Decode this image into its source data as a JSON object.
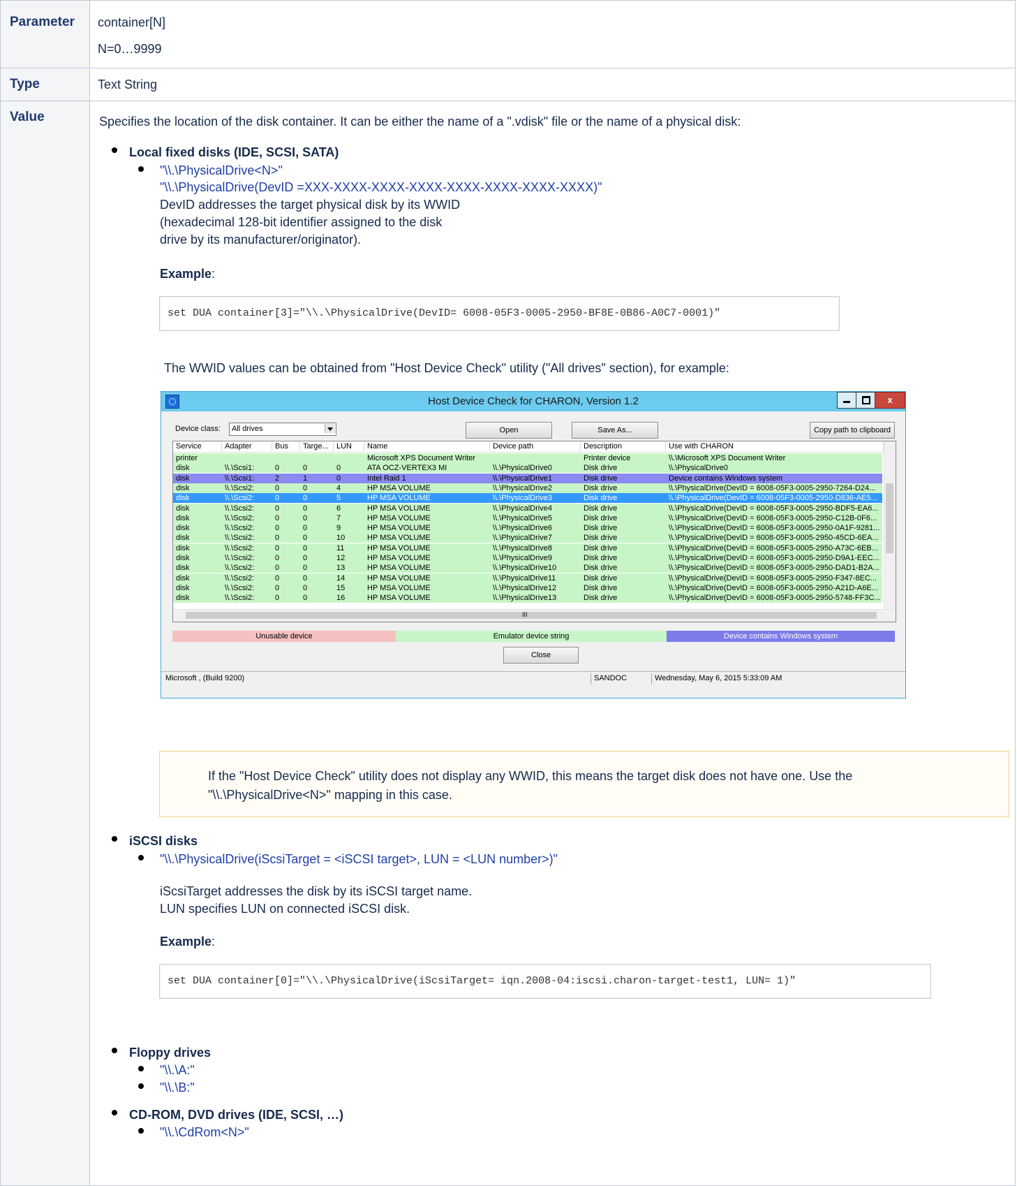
{
  "parameter": {
    "header": "Parameter",
    "line1": "container[N]",
    "line2": "N=0…9999"
  },
  "type": {
    "header": "Type",
    "value": "Text String"
  },
  "value": {
    "header": "Value",
    "intro": "Specifies the location of the disk container. It can be either the name of a \".vdisk\" file or the name of a physical disk:",
    "local_heading": "Local fixed disks (IDE, SCSI, SATA)",
    "local_link1": "\"\\\\.\\PhysicalDrive<N>\"",
    "local_link2": "\"\\\\.\\PhysicalDrive(DevID =XXX-XXXX-XXXX-XXXX-XXXX-XXXX-XXXX-XXXX)\"",
    "devid_desc_1": "DevID addresses the target physical disk by its WWID",
    "devid_desc_2": "(hexadecimal 128-bit identifier assigned to the disk",
    "devid_desc_3": "drive by its manufacturer/originator).",
    "example_label": "Example",
    "example_colon": ":",
    "code1": "set DUA container[3]=\"\\\\.\\PhysicalDrive(DevID= 6008-05F3-0005-2950-BF8E-0B86-A0C7-0001)\"",
    "wwid_note": "The WWID values can be obtained from \"Host Device Check\" utility (\"All drives\" section), for example:",
    "note_line1": "If the \"Host Device Check\" utility does not display any WWID, this means the target disk does not have one. Use the",
    "note_line2": "\"\\\\.\\PhysicalDrive<N>\" mapping in this case.",
    "iscsi_heading": "iSCSI disks",
    "iscsi_link": "\"\\\\.\\PhysicalDrive(iScsiTarget = <iSCSI target>, LUN = <LUN number>)\"",
    "iscsi_desc_1": "iScsiTarget addresses the disk by its iSCSI target name.",
    "iscsi_desc_2": "LUN specifies LUN on connected iSCSI disk.",
    "code2": "set DUA container[0]=\"\\\\.\\PhysicalDrive(iScsiTarget= iqn.2008-04:iscsi.charon-target-test1, LUN= 1)\"",
    "floppy_heading": "Floppy drives",
    "floppy_a": "\"\\\\.\\A:\"",
    "floppy_b": "\"\\\\.\\B:\"",
    "cdrom_heading": "CD-ROM, DVD drives (IDE, SCSI, …)",
    "cdrom_link": "\"\\\\.\\CdRom<N>\""
  },
  "window": {
    "title": "Host Device Check for CHARON, Version 1.2",
    "close_glyph": "x",
    "device_class_label": "Device class:",
    "device_class_value": "All drives",
    "open_button": "Open",
    "save_as_button": "Save As...",
    "copy_button": "Copy path to clipboard",
    "columns": [
      "Service",
      "Adapter",
      "Bus",
      "Targe...",
      "LUN",
      "Name",
      "Device path",
      "Description",
      "Use with CHARON"
    ],
    "rows": [
      [
        "printer",
        "",
        "",
        "",
        "",
        "Microsoft XPS Document Writer",
        "",
        "Printer device",
        "\\\\.\\Microsoft XPS Document Writer"
      ],
      [
        "disk",
        "\\\\.\\Scsi1:",
        "0",
        "0",
        "0",
        "ATA OCZ-VERTEX3 MI",
        "\\\\.\\PhysicalDrive0",
        "Disk drive",
        "\\\\.\\PhysicalDrive0"
      ],
      [
        "disk",
        "\\\\.\\Scsi1:",
        "2",
        "1",
        "0",
        "Intel Raid 1",
        "\\\\.\\PhysicalDrive1",
        "Disk drive",
        "Device contains Windows system"
      ],
      [
        "disk",
        "\\\\.\\Scsi2:",
        "0",
        "0",
        "4",
        "HP MSA VOLUME",
        "\\\\.\\PhysicalDrive2",
        "Disk drive",
        "\\\\.\\PhysicalDrive(DevID = 6008-05F3-0005-2950-7264-D24..."
      ],
      [
        "disk",
        "\\\\.\\Scsi2:",
        "0",
        "0",
        "5",
        "HP MSA VOLUME",
        "\\\\.\\PhysicalDrive3",
        "Disk drive",
        "\\\\.\\PhysicalDrive(DevID = 6008-05F3-0005-2950-D836-AE5..."
      ],
      [
        "disk",
        "\\\\.\\Scsi2:",
        "0",
        "0",
        "6",
        "HP MSA VOLUME",
        "\\\\.\\PhysicalDrive4",
        "Disk drive",
        "\\\\.\\PhysicalDrive(DevID = 6008-05F3-0005-2950-BDF5-EA6..."
      ],
      [
        "disk",
        "\\\\.\\Scsi2:",
        "0",
        "0",
        "7",
        "HP MSA VOLUME",
        "\\\\.\\PhysicalDrive5",
        "Disk drive",
        "\\\\.\\PhysicalDrive(DevID = 6008-05F3-0005-2950-C12B-0F6..."
      ],
      [
        "disk",
        "\\\\.\\Scsi2:",
        "0",
        "0",
        "9",
        "HP MSA VOLUME",
        "\\\\.\\PhysicalDrive6",
        "Disk drive",
        "\\\\.\\PhysicalDrive(DevID = 6008-05F3-0005-2950-0A1F-9281..."
      ],
      [
        "disk",
        "\\\\.\\Scsi2:",
        "0",
        "0",
        "10",
        "HP MSA VOLUME",
        "\\\\.\\PhysicalDrive7",
        "Disk drive",
        "\\\\.\\PhysicalDrive(DevID = 6008-05F3-0005-2950-45CD-6EA..."
      ],
      [
        "disk",
        "\\\\.\\Scsi2:",
        "0",
        "0",
        "11",
        "HP MSA VOLUME",
        "\\\\.\\PhysicalDrive8",
        "Disk drive",
        "\\\\.\\PhysicalDrive(DevID = 6008-05F3-0005-2950-A73C-6EB..."
      ],
      [
        "disk",
        "\\\\.\\Scsi2:",
        "0",
        "0",
        "12",
        "HP MSA VOLUME",
        "\\\\.\\PhysicalDrive9",
        "Disk drive",
        "\\\\.\\PhysicalDrive(DevID = 6008-05F3-0005-2950-D9A1-EEC..."
      ],
      [
        "disk",
        "\\\\.\\Scsi2:",
        "0",
        "0",
        "13",
        "HP MSA VOLUME",
        "\\\\.\\PhysicalDrive10",
        "Disk drive",
        "\\\\.\\PhysicalDrive(DevID = 6008-05F3-0005-2950-DAD1-B2A..."
      ],
      [
        "disk",
        "\\\\.\\Scsi2:",
        "0",
        "0",
        "14",
        "HP MSA VOLUME",
        "\\\\.\\PhysicalDrive11",
        "Disk drive",
        "\\\\.\\PhysicalDrive(DevID = 6008-05F3-0005-2950-F347-8EC..."
      ],
      [
        "disk",
        "\\\\.\\Scsi2:",
        "0",
        "0",
        "15",
        "HP MSA VOLUME",
        "\\\\.\\PhysicalDrive12",
        "Disk drive",
        "\\\\.\\PhysicalDrive(DevID = 6008-05F3-0005-2950-A21D-A6E..."
      ],
      [
        "disk",
        "\\\\.\\Scsi2:",
        "0",
        "0",
        "16",
        "HP MSA VOLUME",
        "\\\\.\\PhysicalDrive13",
        "Disk drive",
        "\\\\.\\PhysicalDrive(DevID = 6008-05F3-0005-2950-5748-FF3C..."
      ]
    ],
    "row_colors": [
      "#c8f5c8",
      "#c8f5c8",
      "#8a8af0",
      "#c8f5c8",
      "#3399ff",
      "#c8f5c8",
      "#c8f5c8",
      "#c8f5c8",
      "#c8f5c8",
      "#c8f5c8",
      "#c8f5c8",
      "#c8f5c8",
      "#c8f5c8",
      "#c8f5c8",
      "#c8f5c8"
    ],
    "scroll_glyph": "III",
    "legend_unusable": "Unusable device",
    "legend_emulator": "Emulator device string",
    "legend_windows": "Device contains Windows system",
    "legend_colors": {
      "unusable": "#f5c0c0",
      "emulator": "#c8f5c8",
      "windows": "#7b7bea"
    },
    "close_button": "Close",
    "status_os": "Microsoft ,  (Build 9200)",
    "status_host": "SANDOC",
    "status_time": "Wednesday, May 6, 2015 5:33:09 AM"
  }
}
